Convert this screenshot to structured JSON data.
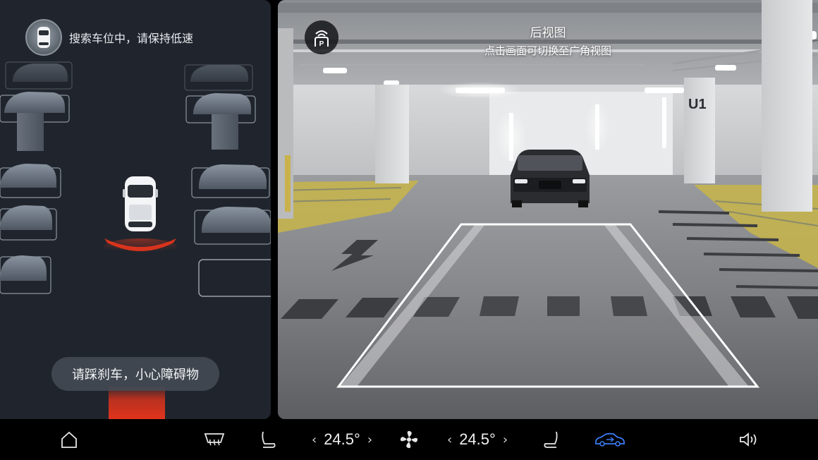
{
  "parking": {
    "status_text": "搜索车位中，请保持低速",
    "toast_text": "请踩刹车，小心障碍物"
  },
  "camera": {
    "title": "后视图",
    "subtitle": "点击画面可切换至广角视图",
    "pillar_label": "U1"
  },
  "climate": {
    "left_temp": "24.5°",
    "right_temp": "24.5°"
  },
  "icons": {
    "home": "home-icon",
    "defrost": "rear-defrost-icon",
    "seat_left": "seat-heat-left-icon",
    "fan": "fan-icon",
    "seat_right": "seat-heat-right-icon",
    "car": "vehicle-icon",
    "volume": "volume-icon"
  },
  "colors": {
    "accent_blue": "#3b7bf5",
    "warning_red": "#e0341c",
    "panel_bg": "#20252d"
  }
}
